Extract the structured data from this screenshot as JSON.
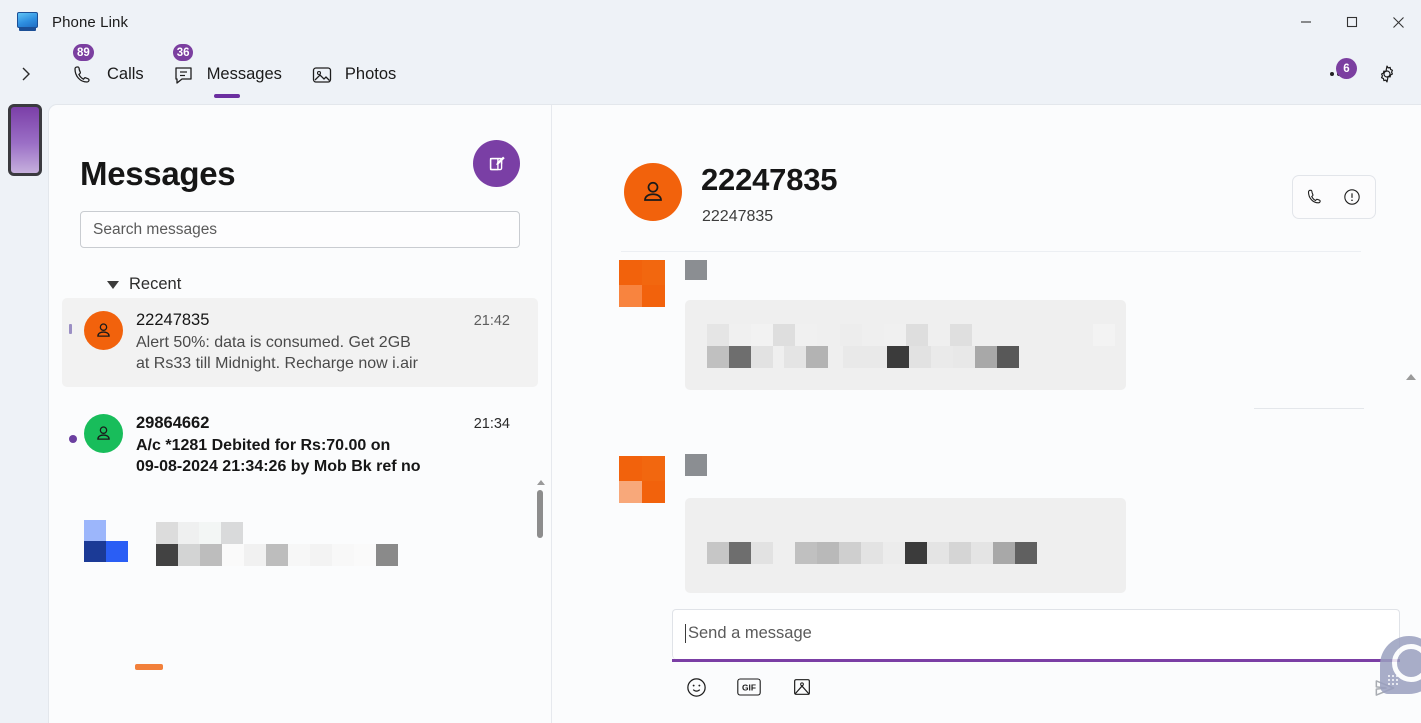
{
  "window": {
    "title": "Phone Link",
    "app_icon": "monitor-icon",
    "controls": {
      "minimize": "minimize-icon",
      "maximize": "maximize-icon",
      "close": "close-icon"
    }
  },
  "navbar": {
    "expand_icon": "chevron-right-icon",
    "tabs": [
      {
        "label": "Calls",
        "icon": "phone-icon",
        "badge": "89",
        "active": false
      },
      {
        "label": "Messages",
        "icon": "chat-bubble-icon",
        "badge": "36",
        "active": true
      },
      {
        "label": "Photos",
        "icon": "photo-icon",
        "badge": "",
        "active": false
      }
    ],
    "overflow": {
      "icon": "more-dots-icon",
      "badge": "6"
    },
    "settings": {
      "icon": "gear-icon"
    }
  },
  "device_rail": {
    "device_thumbnail": "phone-device-thumbnail"
  },
  "left_pane": {
    "title": "Messages",
    "compose": {
      "icon": "compose-new-message-icon",
      "color": "#7a3fa5"
    },
    "search": {
      "value": "",
      "placeholder": "Search messages"
    },
    "section": {
      "label": "Recent",
      "expanded": true
    },
    "conversations": [
      {
        "name": "22247835",
        "time": "21:42",
        "snippet": "Alert 50%: data is consumed. Get 2GB\nat Rs33 till Midnight. Recharge now i.air",
        "avatar_color": "#f2620c",
        "unread": false,
        "selected": true
      },
      {
        "name": "29864662",
        "time": "21:34",
        "snippet": "A/c *1281 Debited for Rs:70.00 on\n09-08-2024 21:34:26 by Mob Bk ref no",
        "avatar_color": "#18bd5b",
        "unread": true,
        "selected": false
      },
      {
        "name": "",
        "time": "",
        "snippet": "",
        "avatar_color": "#2a58d8",
        "unread": true,
        "selected": false,
        "redacted": true
      }
    ]
  },
  "conversation": {
    "contact_name": "22247835",
    "contact_subtitle": "22247835",
    "avatar_color": "#f2620c",
    "actions": [
      {
        "icon": "phone-call-icon",
        "name": "call-contact-button"
      },
      {
        "icon": "info-circle-icon",
        "name": "conversation-info-button"
      }
    ],
    "messages": [
      {
        "sender_redacted": true,
        "body_redacted": true,
        "avatar_color": "#f2620c"
      },
      {
        "sender_redacted": true,
        "body_redacted": true,
        "avatar_color": "#f2620c"
      }
    ]
  },
  "composer": {
    "value": "",
    "placeholder": "Send a message",
    "accent": "#7b3fa5",
    "tools": [
      {
        "icon": "emoji-icon",
        "label": ""
      },
      {
        "icon": "gif-icon",
        "label": "GIF"
      },
      {
        "icon": "image-icon",
        "label": ""
      }
    ],
    "send": {
      "icon": "send-icon"
    }
  },
  "scrollbars": {
    "list": {
      "position": "top"
    },
    "thread": {
      "position": "bottom"
    }
  }
}
